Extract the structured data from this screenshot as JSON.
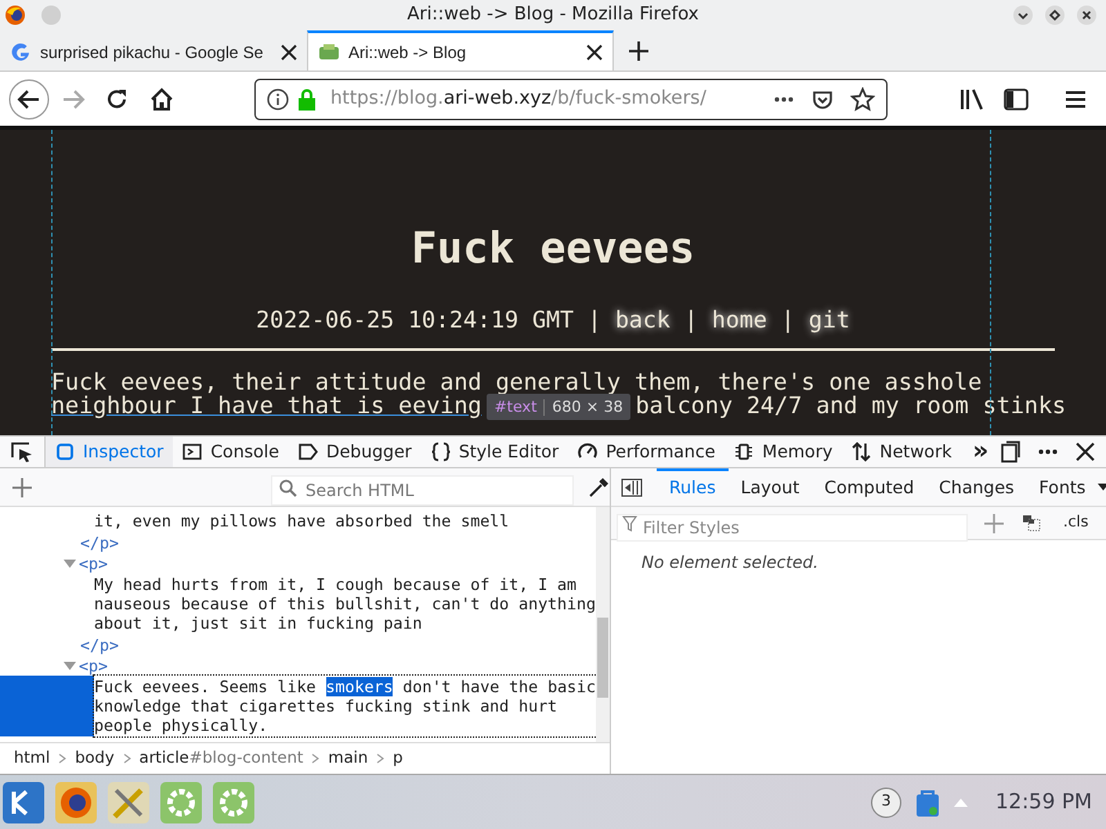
{
  "window": {
    "title": "Ari::web -> Blog - Mozilla Firefox"
  },
  "tabs": [
    {
      "label": "surprised pikachu - Google Se",
      "selected": false
    },
    {
      "label": "Ari::web -> Blog",
      "selected": true
    }
  ],
  "address_bar": {
    "url_start": "https://blog.",
    "url_domain": "ari-web.xyz",
    "url_end": "/b/fuck-smokers/"
  },
  "nav": {
    "forward_disabled": true
  },
  "page": {
    "title": "Fuck eevees",
    "meta": "2022-06-25 10:24:19 GMT",
    "links": [
      "back",
      "home",
      "git"
    ],
    "separator": "|",
    "paragraph_line_1": "Fuck eevees, their attitude and generally them, there's one asshole",
    "paragraph_line_2_start": "neighbour I have that is eeving",
    "paragraph_line_2_end": "balcony 24/7 and my room stinks",
    "tooltip": {
      "node": "#text",
      "size": "680 × 38"
    }
  },
  "devtools": {
    "tools": [
      {
        "label": "Inspector",
        "selected": true
      },
      {
        "label": "Console",
        "selected": false
      },
      {
        "label": "Debugger",
        "selected": false
      },
      {
        "label": "Style Editor",
        "selected": false
      },
      {
        "label": "Performance",
        "selected": false
      },
      {
        "label": "Memory",
        "selected": false
      },
      {
        "label": "Network",
        "selected": false
      }
    ],
    "overflow": "»",
    "search_placeholder": "Search HTML",
    "markup": [
      {
        "kind": "text",
        "segments": [
          {
            "text": "it, even my pillows have absorbed the smell",
            "highlighted": false
          }
        ],
        "selected": false
      },
      {
        "kind": "close",
        "tag": "</p>"
      },
      {
        "kind": "open",
        "tag": "<p>",
        "expanded": true
      },
      {
        "kind": "text",
        "segments": [
          {
            "text": "My head hurts from it, I cough because of it, I am nauseous because of this bullshit, can't do anything about it, just sit in fucking pain",
            "highlighted": false
          }
        ],
        "selected": false
      },
      {
        "kind": "close",
        "tag": "</p>"
      },
      {
        "kind": "open",
        "tag": "<p>",
        "expanded": true
      },
      {
        "kind": "text",
        "segments": [
          {
            "text": "Fuck eevees. Seems like ",
            "highlighted": false
          },
          {
            "text": "smokers",
            "highlighted": true
          },
          {
            "text": " don't have the basic knowledge that cigarettes fucking stink and hurt people physically.",
            "highlighted": false
          }
        ],
        "selected": true
      }
    ],
    "breadcrumbs": [
      {
        "tag": "html"
      },
      {
        "tag": "body"
      },
      {
        "tag": "article",
        "id": "#blog-content"
      },
      {
        "tag": "main"
      },
      {
        "tag": "p"
      }
    ],
    "sidebar_tabs": [
      {
        "label": "Rules",
        "selected": true
      },
      {
        "label": "Layout",
        "selected": false
      },
      {
        "label": "Computed",
        "selected": false
      },
      {
        "label": "Changes",
        "selected": false
      },
      {
        "label": "Fonts",
        "selected": false
      }
    ],
    "filter_placeholder": "Filter Styles",
    "cls": ".cls",
    "empty_message": "No element selected."
  },
  "taskbar": {
    "badge": "3",
    "clock": "12:59 PM"
  }
}
